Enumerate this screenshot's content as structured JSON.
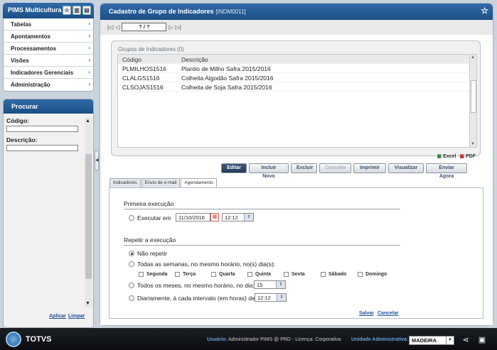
{
  "app": {
    "title": "PIMS Multicultura"
  },
  "menu": {
    "items": [
      {
        "label": "Tabelas"
      },
      {
        "label": "Apontamentos"
      },
      {
        "label": "Processamentos"
      },
      {
        "label": "Visões"
      },
      {
        "label": "Indicadores Gerenciais"
      },
      {
        "label": "Administração"
      }
    ]
  },
  "search": {
    "title": "Procurar",
    "code_label": "Código:",
    "desc_label": "Descrição:",
    "apply": "Aplicar",
    "clear": "Limpar"
  },
  "page": {
    "title": "Cadastro de Grupo de Indicadores",
    "code": "[INDM0011]",
    "record": "? / ?"
  },
  "grid": {
    "title": "Grupos de Indicadores (0)",
    "columns": [
      "Código",
      "Descrição"
    ],
    "rows": [
      {
        "code": "PLMILHOS1516",
        "desc": "Plantio de Milho Safra 2015/2016"
      },
      {
        "code": "CLALGS1516",
        "desc": "Colheita Algodão Safra 2015/2016"
      },
      {
        "code": "CLSOJAS1516",
        "desc": "Colheita de Soja Safra 2015/2016"
      }
    ],
    "excel": "Excel",
    "pdf": "PDF"
  },
  "actions": {
    "edit": "Editar",
    "new": "Incluir Novo",
    "delete": "Excluir",
    "cancel": "Cancelar",
    "print": "Imprimir",
    "view": "Visualizar",
    "send": "Enviar Agora"
  },
  "tabs": [
    "Indicadores",
    "Envio de e-mail",
    "Agendamento"
  ],
  "schedule": {
    "first_title": "Primeira execução",
    "run_at": "Executar em",
    "date": "11/10/2016",
    "time": "12:12",
    "repeat_title": "Repetir a execução",
    "no_repeat": "Não repetir",
    "weekly": "Todas as semanas, no mesmo horário, no(s) dia(s):",
    "days": [
      "Segunda",
      "Terça",
      "Quarta",
      "Quinta",
      "Sexta",
      "Sábado",
      "Domingo"
    ],
    "monthly": "Todos os meses, no mesmo horário, no dia:",
    "monthly_day": "15",
    "daily": "Diariamente, à cada intervalo (em horas) de:",
    "interval": "12:12",
    "save": "Salvar",
    "cancel": "Cancelar"
  },
  "footer": {
    "brand": "TOTVS",
    "user_label": "Usuário:",
    "user_value": "Administrador PIMS @ PRD - Licença: Corporativa",
    "unit_label": "Unidade Administrativa:",
    "unit_value": "MADEIRA"
  },
  "colors": {
    "header_blue": "#1d4f86",
    "primary_button": "#223a56",
    "footer": "#0b0d10"
  }
}
